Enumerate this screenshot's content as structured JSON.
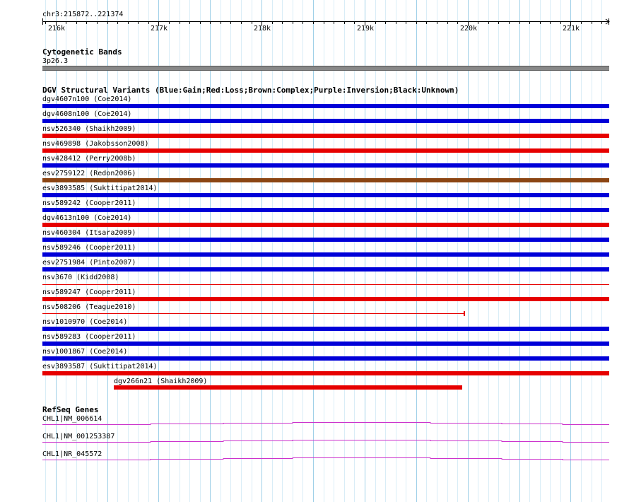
{
  "ruler": {
    "coord_label": "chr3:215872..221374",
    "ticks": [
      "216k",
      "217k",
      "218k",
      "219k",
      "220k",
      "221k"
    ],
    "start": 215872,
    "end": 221374
  },
  "cytobands": {
    "title": "Cytogenetic Bands",
    "band_label": "3p26.3"
  },
  "dgv": {
    "title": "DGV Structural Variants (Blue:Gain;Red:Loss;Brown:Complex;Purple:Inversion;Black:Unknown)",
    "colors": {
      "gain": "#0000d8",
      "loss": "#e60000",
      "complex": "#8b4513",
      "inversion": "#800080",
      "unknown": "#000000"
    },
    "variants": [
      {
        "label": "dgv4607n100 (Coe2014)",
        "type": "gain",
        "style": "full"
      },
      {
        "label": "dgv4608n100 (Coe2014)",
        "type": "gain",
        "style": "full"
      },
      {
        "label": "nsv526340 (Shaikh2009)",
        "type": "loss",
        "style": "full"
      },
      {
        "label": "nsv469898 (Jakobsson2008)",
        "type": "loss",
        "style": "full"
      },
      {
        "label": "nsv428412 (Perry2008b)",
        "type": "gain",
        "style": "full"
      },
      {
        "label": "esv2759122 (Redon2006)",
        "type": "complex",
        "style": "full"
      },
      {
        "label": "esv3893585 (Suktitipat2014)",
        "type": "gain",
        "style": "full"
      },
      {
        "label": "nsv589242 (Cooper2011)",
        "type": "gain",
        "style": "full"
      },
      {
        "label": "dgv4613n100 (Coe2014)",
        "type": "loss",
        "style": "full"
      },
      {
        "label": "nsv460304 (Itsara2009)",
        "type": "gain",
        "style": "full"
      },
      {
        "label": "nsv589246 (Cooper2011)",
        "type": "gain",
        "style": "full"
      },
      {
        "label": "esv2751984 (Pinto2007)",
        "type": "gain",
        "style": "full"
      },
      {
        "label": "nsv3670 (Kidd2008)",
        "type": "loss",
        "style": "thin"
      },
      {
        "label": "nsv589247 (Cooper2011)",
        "type": "loss",
        "style": "full"
      },
      {
        "label": "nsv508206 (Teague2010)",
        "type": "loss",
        "style": "thin-end",
        "end": 219962
      },
      {
        "label": "nsv1010970 (Coe2014)",
        "type": "gain",
        "style": "full"
      },
      {
        "label": "nsv589283 (Cooper2011)",
        "type": "gain",
        "style": "full"
      },
      {
        "label": "nsv1001867 (Coe2014)",
        "type": "gain",
        "style": "full"
      },
      {
        "label": "esv3893587 (Suktitipat2014)",
        "type": "loss",
        "style": "full"
      },
      {
        "label": "dgv266n21 (Shaikh2009)",
        "type": "loss",
        "style": "partial",
        "start": 216567,
        "end": 219945
      }
    ]
  },
  "refseq": {
    "title": "RefSeq Genes",
    "color": "#cc33cc",
    "genes": [
      {
        "label": "CHL1|NM_006614"
      },
      {
        "label": "CHL1|NM_001253387"
      },
      {
        "label": "CHL1|NR_045572"
      }
    ]
  }
}
